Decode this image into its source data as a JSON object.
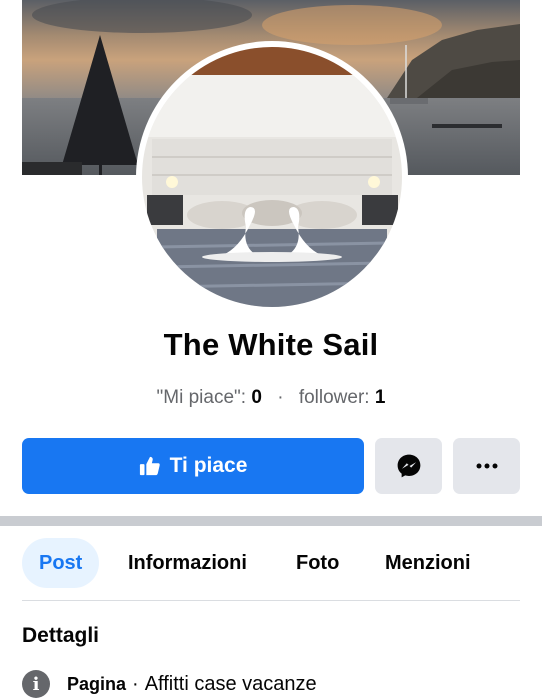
{
  "profile": {
    "name": "The White Sail",
    "likes_label": "\"Mi piace\":",
    "likes_count": "0",
    "followers_label": "follower:",
    "followers_count": "1",
    "separator": "·"
  },
  "actions": {
    "like_label": "Ti piace",
    "like_icon": "thumbs-up-icon",
    "messenger_icon": "messenger-icon",
    "more_icon": "more-dots-icon"
  },
  "tabs": [
    {
      "label": "Post",
      "active": true
    },
    {
      "label": "Informazioni",
      "active": false
    },
    {
      "label": "Foto",
      "active": false
    },
    {
      "label": "Menzioni",
      "active": false
    }
  ],
  "details": {
    "title": "Dettagli",
    "row_label": "Pagina",
    "row_separator": "·",
    "row_value": "Affitti case vacanze",
    "row_icon": "info-icon"
  },
  "colors": {
    "accent": "#1877f2",
    "tab_active_bg": "#e7f3ff",
    "secondary_button": "#e4e6eb",
    "muted_text": "#65676b"
  }
}
